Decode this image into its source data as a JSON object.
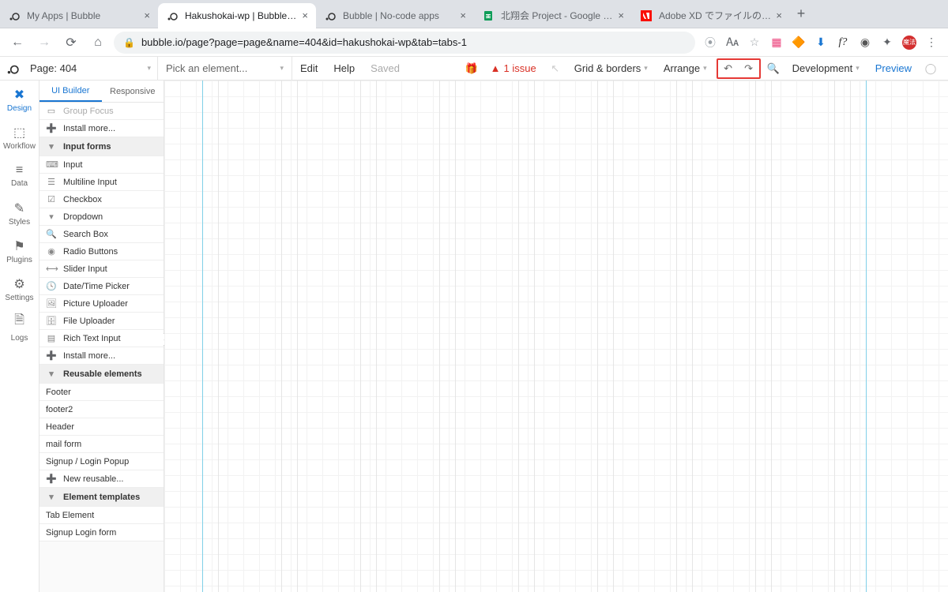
{
  "browser": {
    "tabs": [
      {
        "title": "My Apps | Bubble",
        "favicon": "bubble"
      },
      {
        "title": "Hakushokai-wp | Bubble Editor",
        "favicon": "bubble",
        "active": true
      },
      {
        "title": "Bubble | No-code apps",
        "favicon": "bubble"
      },
      {
        "title": "北翔会 Project - Google スプレ",
        "favicon": "sheets"
      },
      {
        "title": "Adobe XD でファイルのインポー",
        "favicon": "adobe"
      }
    ],
    "url": "bubble.io/page?page=page&name=404&id=hakushokai-wp&tab=tabs-1"
  },
  "header": {
    "page_label": "Page: 404",
    "pick_label": "Pick an element...",
    "edit": "Edit",
    "help": "Help",
    "saved": "Saved",
    "issues_count": "1 issue",
    "grid_borders": "Grid & borders",
    "arrange": "Arrange",
    "development": "Development",
    "preview": "Preview"
  },
  "rail": {
    "items": [
      "Design",
      "Workflow",
      "Data",
      "Styles",
      "Plugins",
      "Settings",
      "Logs"
    ]
  },
  "palette": {
    "tabs": {
      "ui_builder": "UI Builder",
      "responsive": "Responsive"
    },
    "truncated_top": "Group Focus",
    "install_more": "Install more...",
    "section_input": "Input forms",
    "items_input": [
      "Input",
      "Multiline Input",
      "Checkbox",
      "Dropdown",
      "Search Box",
      "Radio Buttons",
      "Slider Input",
      "Date/Time Picker",
      "Picture Uploader",
      "File Uploader",
      "Rich Text Input"
    ],
    "section_reusable": "Reusable elements",
    "items_reusable": [
      "Footer",
      "footer2",
      "Header",
      "mail form",
      "Signup / Login Popup"
    ],
    "new_reusable": "New reusable...",
    "section_templates": "Element templates",
    "items_templates": [
      "Tab Element",
      "Signup Login form"
    ]
  }
}
